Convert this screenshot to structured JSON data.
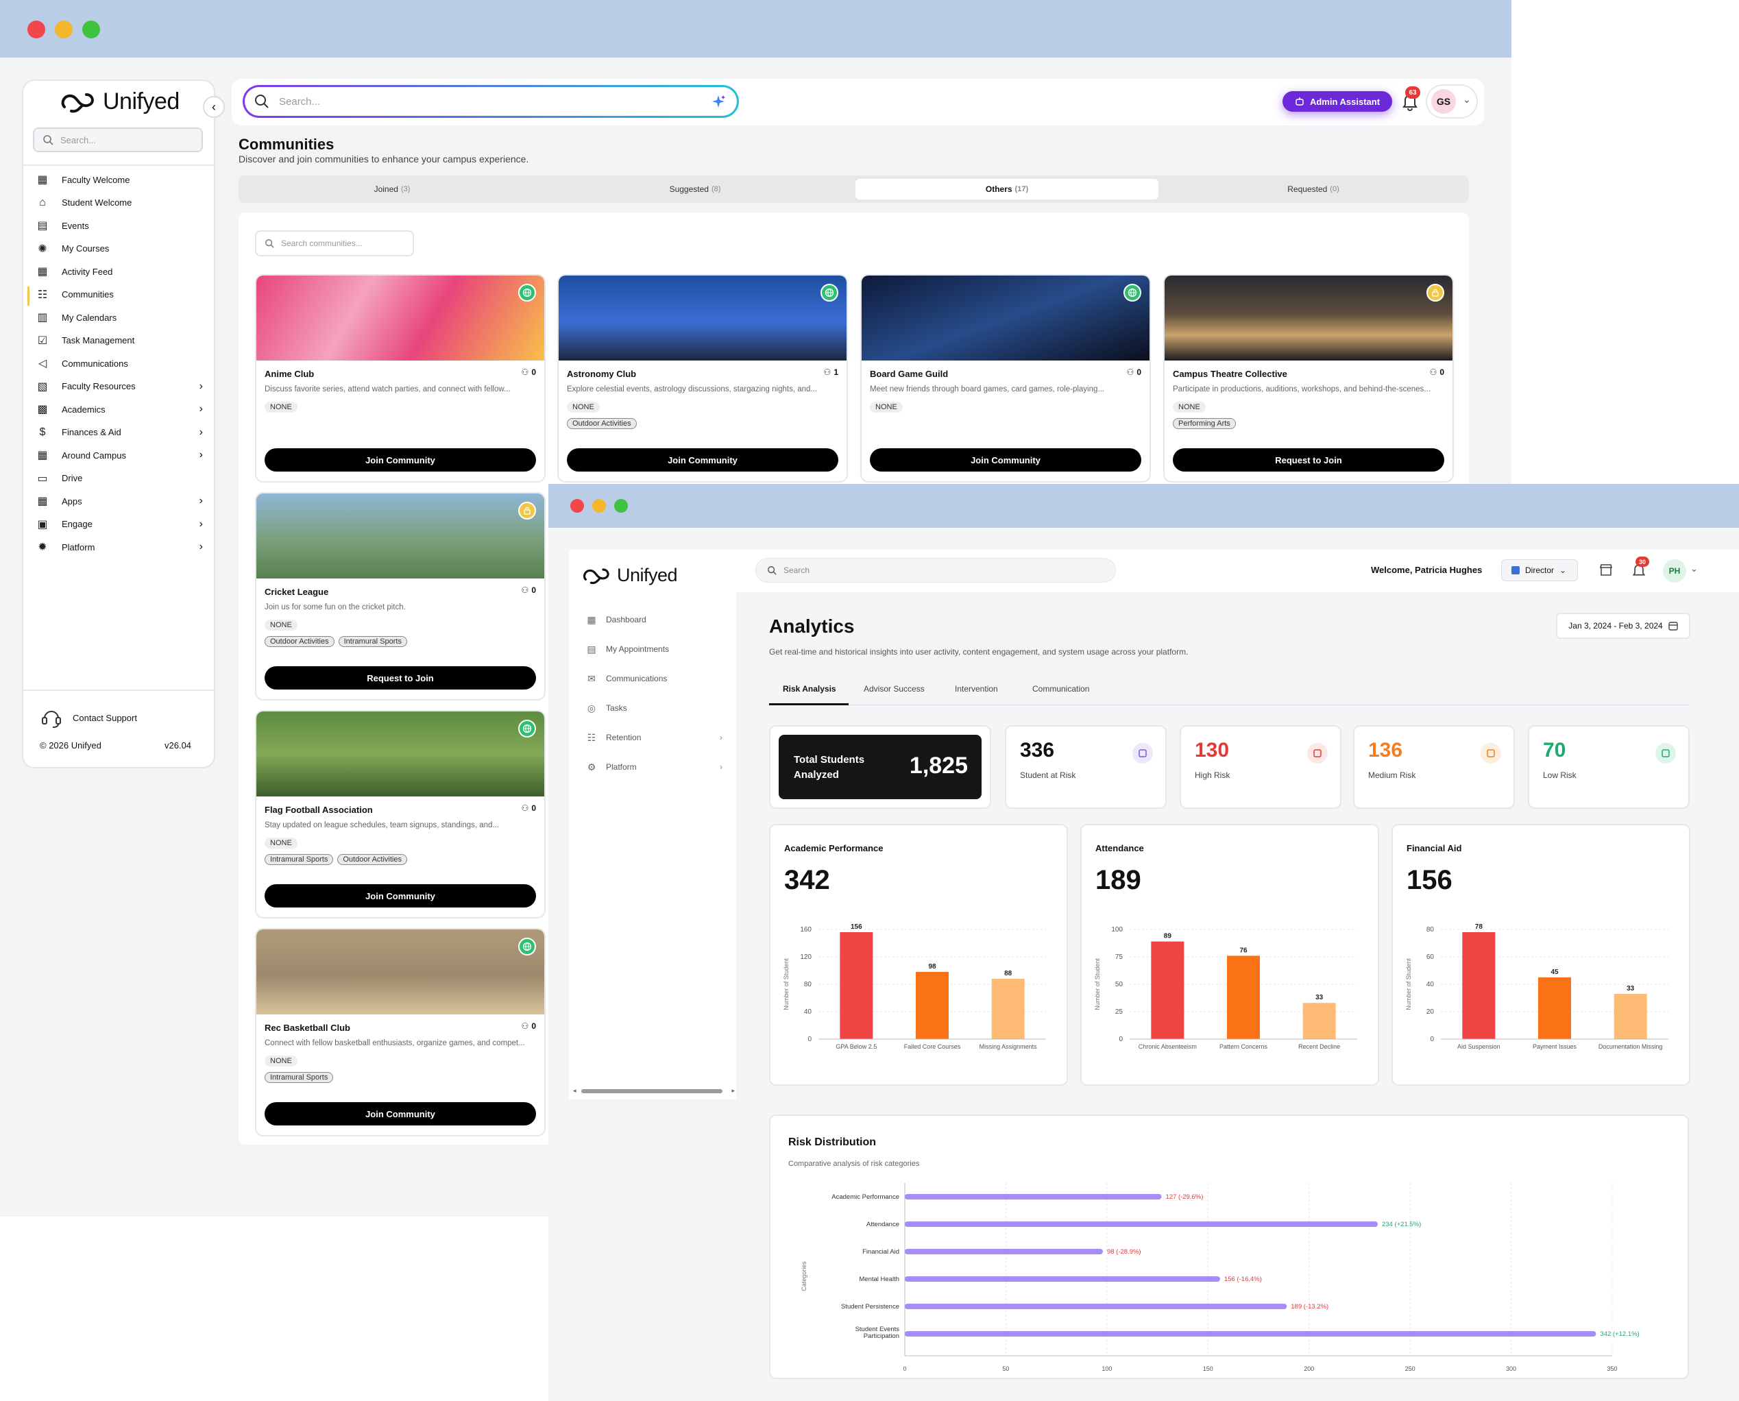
{
  "communities_app": {
    "brand": "Unifyed",
    "sidebar_search_placeholder": "Search...",
    "nav": [
      {
        "label": "Faculty Welcome",
        "icon": "layout-icon"
      },
      {
        "label": "Student Welcome",
        "icon": "home-icon"
      },
      {
        "label": "Events",
        "icon": "calendar-icon"
      },
      {
        "label": "My Courses",
        "icon": "courses-icon"
      },
      {
        "label": "Activity Feed",
        "icon": "feed-icon"
      },
      {
        "label": "Communities",
        "icon": "users-icon"
      },
      {
        "label": "My Calendars",
        "icon": "calendar-grid-icon"
      },
      {
        "label": "Task Management",
        "icon": "task-icon"
      },
      {
        "label": "Communications",
        "icon": "megaphone-icon"
      },
      {
        "label": "Faculty Resources",
        "icon": "resources-icon"
      },
      {
        "label": "Academics",
        "icon": "academics-icon"
      },
      {
        "label": "Finances & Aid",
        "icon": "dollar-icon"
      },
      {
        "label": "Around Campus",
        "icon": "campus-icon"
      },
      {
        "label": "Drive",
        "icon": "drive-icon"
      },
      {
        "label": "Apps",
        "icon": "apps-icon"
      },
      {
        "label": "Engage",
        "icon": "engage-icon"
      },
      {
        "label": "Platform",
        "icon": "platform-icon"
      }
    ],
    "contact_support": "Contact Support",
    "copyright": "© 2026 Unifyed",
    "version": "v26.04",
    "search_placeholder": "Search...",
    "admin_assistant": "Admin Assistant",
    "notification_count": "63",
    "avatar_initials": "GS",
    "page_title": "Communities",
    "page_subtitle": "Discover and join communities to enhance your campus experience.",
    "tabs": [
      {
        "label": "Joined",
        "count": "(3)"
      },
      {
        "label": "Suggested",
        "count": "(8)"
      },
      {
        "label": "Others",
        "count": "(17)"
      },
      {
        "label": "Requested",
        "count": "(0)"
      }
    ],
    "community_search_placeholder": "Search communities...",
    "cards": [
      {
        "title": "Anime Club",
        "members": "0",
        "desc": "Discuss favorite series, attend watch parties, and connect with fellow...",
        "privacy": "NONE",
        "tags": [],
        "button": "Join Community",
        "badge": "globe"
      },
      {
        "title": "Astronomy Club",
        "members": "1",
        "desc": "Explore celestial events, astrology discussions, stargazing nights, and...",
        "privacy": "NONE",
        "tags": [
          "Outdoor Activities"
        ],
        "button": "Join Community",
        "badge": "globe"
      },
      {
        "title": "Board Game Guild",
        "members": "0",
        "desc": "Meet new friends through board games, card games, role-playing...",
        "privacy": "NONE",
        "tags": [],
        "button": "Join Community",
        "badge": "globe"
      },
      {
        "title": "Campus Theatre Collective",
        "members": "0",
        "desc": "Participate in productions, auditions, workshops, and behind-the-scenes...",
        "privacy": "NONE",
        "tags": [
          "Performing Arts"
        ],
        "button": "Request to Join",
        "badge": "lock"
      },
      {
        "title": "Cricket League",
        "members": "0",
        "desc": "Join us for some fun on the cricket pitch.",
        "privacy": "NONE",
        "tags": [
          "Outdoor Activities",
          "Intramural Sports"
        ],
        "button": "Request to Join",
        "badge": "lock"
      },
      {
        "title": "Flag Football Association",
        "members": "0",
        "desc": "Stay updated on league schedules, team signups, standings, and...",
        "privacy": "NONE",
        "tags": [
          "Intramural Sports",
          "Outdoor Activities"
        ],
        "button": "Join Community",
        "badge": "globe"
      },
      {
        "title": "Rec Basketball Club",
        "members": "0",
        "desc": "Connect with fellow basketball enthusiasts, organize games, and compet...",
        "privacy": "NONE",
        "tags": [
          "Intramural Sports"
        ],
        "button": "Join Community",
        "badge": "globe"
      }
    ]
  },
  "analytics_app": {
    "brand": "Unifyed",
    "nav": [
      {
        "label": "Dashboard",
        "icon": "dashboard-icon"
      },
      {
        "label": "My Appointments",
        "icon": "calendar-icon"
      },
      {
        "label": "Communications",
        "icon": "mail-icon"
      },
      {
        "label": "Tasks",
        "icon": "check-circle-icon"
      },
      {
        "label": "Retention",
        "icon": "users-icon"
      },
      {
        "label": "Platform",
        "icon": "gear-icon"
      }
    ],
    "search_placeholder": "Search",
    "welcome": "Welcome, Patricia Hughes",
    "role": "Director",
    "notification_count": "30",
    "avatar_initials": "PH",
    "title": "Analytics",
    "subtitle": "Get real-time and historical insights into user activity, content engagement, and system usage across your platform.",
    "date_range": "Jan 3, 2024 - Feb 3, 2024",
    "tabs": [
      "Risk Analysis",
      "Advisor Success",
      "Intervention",
      "Communication"
    ],
    "total_label": "Total Students Analyzed",
    "total_value": "1,825",
    "stats": [
      {
        "value": "336",
        "label": "Student at Risk",
        "color": "#111111",
        "icon_bg": "#ede7fb",
        "icon_color": "#7c5cd6"
      },
      {
        "value": "130",
        "label": "High Risk",
        "color": "#e53935",
        "icon_bg": "#fde8e8",
        "icon_color": "#e53935"
      },
      {
        "value": "136",
        "label": "Medium Risk",
        "color": "#f57c1f",
        "icon_bg": "#fdeedd",
        "icon_color": "#f57c1f"
      },
      {
        "value": "70",
        "label": "Low Risk",
        "color": "#1faa6b",
        "icon_bg": "#e0f5ea",
        "icon_color": "#1faa6b"
      }
    ],
    "chart_data": [
      {
        "type": "bar",
        "title": "Academic Performance",
        "total": "342",
        "ylabel": "Number of Student",
        "categories": [
          "GPA Below 2.5",
          "Failed Core Courses",
          "Missing Assignments"
        ],
        "values": [
          156,
          98,
          88
        ],
        "ylim": [
          0,
          160
        ],
        "yticks": [
          0,
          40,
          80,
          120,
          160
        ],
        "colors": [
          "#ef4444",
          "#f97316",
          "#fdba74"
        ]
      },
      {
        "type": "bar",
        "title": "Attendance",
        "total": "189",
        "ylabel": "Number of Student",
        "categories": [
          "Chronic Absenteeism",
          "Pattern Concerns",
          "Recent Decline"
        ],
        "values": [
          89,
          76,
          33
        ],
        "ylim": [
          0,
          100
        ],
        "yticks": [
          0,
          25,
          50,
          75,
          100
        ],
        "colors": [
          "#ef4444",
          "#f97316",
          "#fdba74"
        ]
      },
      {
        "type": "bar",
        "title": "Financial Aid",
        "total": "156",
        "ylabel": "Number of Student",
        "categories": [
          "Aid Suspension",
          "Payment Issues",
          "Documentation Missing"
        ],
        "values": [
          78,
          45,
          33
        ],
        "ylim": [
          0,
          80
        ],
        "yticks": [
          0,
          20,
          40,
          60,
          80
        ],
        "colors": [
          "#ef4444",
          "#f97316",
          "#fdba74"
        ]
      },
      {
        "type": "bar",
        "orientation": "horizontal",
        "title": "Risk Distribution",
        "subtitle": "Comparative analysis of risk categories",
        "ylabel": "Categories",
        "categories": [
          "Academic Performance",
          "Attendance",
          "Financial Aid",
          "Mental Health",
          "Student Persistence",
          "Student Events Participation"
        ],
        "values": [
          127,
          234,
          98,
          156,
          189,
          342
        ],
        "labels": [
          "127 (-29.6%)",
          "234 (+21.5%)",
          "98 (-28.9%)",
          "156 (-16.4%)",
          "189 (-13.2%)",
          "342 (+12.1%)"
        ],
        "label_colors": [
          "#e53935",
          "#1faa6b",
          "#e53935",
          "#e53935",
          "#e53935",
          "#1faa6b"
        ],
        "xlim": [
          0,
          350
        ],
        "xticks": [
          0,
          50,
          100,
          150,
          200,
          250,
          300,
          350
        ],
        "color": "#a78bfa"
      }
    ]
  }
}
